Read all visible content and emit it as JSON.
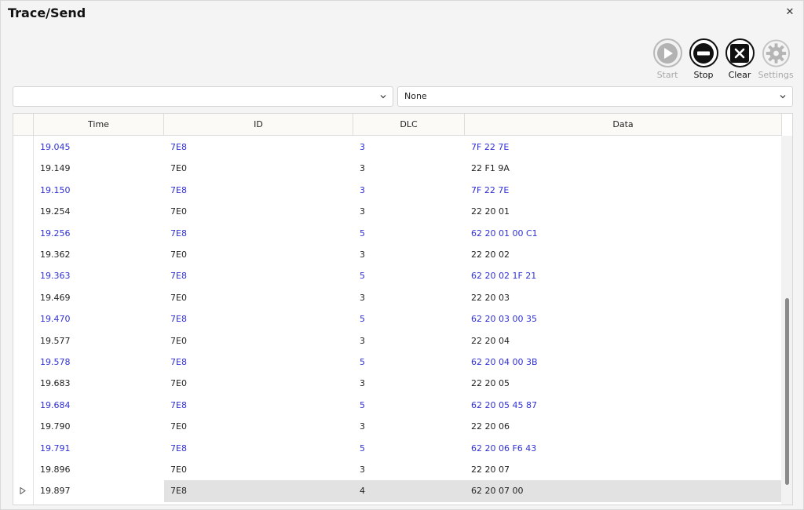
{
  "window": {
    "title": "Trace/Send",
    "close_glyph": "✕"
  },
  "toolbar": {
    "start": {
      "label": "Start",
      "icon": "play-icon",
      "enabled": false
    },
    "stop": {
      "label": "Stop",
      "icon": "stop-icon",
      "enabled": true
    },
    "clear": {
      "label": "Clear",
      "icon": "clear-icon",
      "enabled": true
    },
    "settings": {
      "label": "Settings",
      "icon": "gear-icon",
      "enabled": false
    }
  },
  "filters": {
    "left": {
      "value": ""
    },
    "right": {
      "value": "None"
    }
  },
  "table": {
    "columns": [
      "Time",
      "ID",
      "DLC",
      "Data"
    ],
    "rows": [
      {
        "time": "19.045",
        "id": "7E8",
        "dlc": "3",
        "data": "7F 22 7E",
        "color": "blue"
      },
      {
        "time": "19.149",
        "id": "7E0",
        "dlc": "3",
        "data": "22 F1 9A",
        "color": "black"
      },
      {
        "time": "19.150",
        "id": "7E8",
        "dlc": "3",
        "data": "7F 22 7E",
        "color": "blue"
      },
      {
        "time": "19.254",
        "id": "7E0",
        "dlc": "3",
        "data": "22 20 01",
        "color": "black"
      },
      {
        "time": "19.256",
        "id": "7E8",
        "dlc": "5",
        "data": "62 20 01 00 C1",
        "color": "blue"
      },
      {
        "time": "19.362",
        "id": "7E0",
        "dlc": "3",
        "data": "22 20 02",
        "color": "black"
      },
      {
        "time": "19.363",
        "id": "7E8",
        "dlc": "5",
        "data": "62 20 02 1F 21",
        "color": "blue"
      },
      {
        "time": "19.469",
        "id": "7E0",
        "dlc": "3",
        "data": "22 20 03",
        "color": "black"
      },
      {
        "time": "19.470",
        "id": "7E8",
        "dlc": "5",
        "data": "62 20 03 00 35",
        "color": "blue"
      },
      {
        "time": "19.577",
        "id": "7E0",
        "dlc": "3",
        "data": "22 20 04",
        "color": "black"
      },
      {
        "time": "19.578",
        "id": "7E8",
        "dlc": "5",
        "data": "62 20 04 00 3B",
        "color": "blue"
      },
      {
        "time": "19.683",
        "id": "7E0",
        "dlc": "3",
        "data": "22 20 05",
        "color": "black"
      },
      {
        "time": "19.684",
        "id": "7E8",
        "dlc": "5",
        "data": "62 20 05 45 87",
        "color": "blue"
      },
      {
        "time": "19.790",
        "id": "7E0",
        "dlc": "3",
        "data": "22 20 06",
        "color": "black"
      },
      {
        "time": "19.791",
        "id": "7E8",
        "dlc": "5",
        "data": "62 20 06 F6 43",
        "color": "blue"
      },
      {
        "time": "19.896",
        "id": "7E0",
        "dlc": "3",
        "data": "22 20 07",
        "color": "black"
      },
      {
        "time": "19.897",
        "id": "7E8",
        "dlc": "4",
        "data": "62 20 07 00",
        "color": "black",
        "selected": true
      }
    ]
  },
  "colors": {
    "blue_text": "#2f2fd6",
    "black_text": "#222222",
    "selected_row": "#e2e2e2"
  }
}
